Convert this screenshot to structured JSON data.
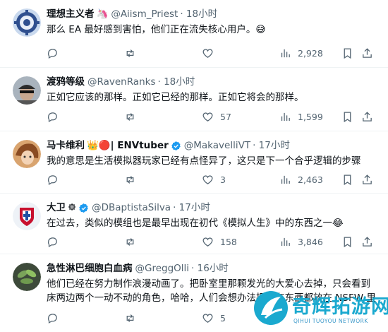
{
  "tweets": [
    {
      "name": "理想主义者",
      "name_emoji": "🦄",
      "handle": "@Aiism_Priest",
      "time": "· 18小时",
      "text": "那么 EA 最好感到害怕，他们正在流失核心用户。😅",
      "verified": false,
      "reply_count": "",
      "retweet_count": "",
      "like_count": "",
      "view_count": "2,928",
      "avatar_icon": "blue-gear-avatar"
    },
    {
      "name": "渡鸦等级",
      "name_emoji": "",
      "handle": "@RavenRanks",
      "time": "· 18小时",
      "text": "正如它应该的那样。正如它已经的那样。正如它将会的那样。",
      "verified": false,
      "reply_count": "",
      "retweet_count": "",
      "like_count": "57",
      "view_count": "1,599",
      "avatar_icon": "man-with-cap-avatar"
    },
    {
      "name": "马卡维利",
      "name_emoji": "👑🔴| ENVtuber",
      "handle": "@MakavelliVT",
      "time": "· 17小时",
      "text": "我的意思是生活模拟器玩家已经有点怪异了，这只是下一个合乎逻辑的步骤",
      "verified": true,
      "reply_count": "",
      "retweet_count": "",
      "like_count": "3",
      "view_count": "2,463",
      "avatar_icon": "anime-character-avatar"
    },
    {
      "name": "大卫",
      "name_emoji": "☸",
      "handle": "@DBaptistaSilva",
      "time": "· 17小时",
      "text": "在过去，类似的模组也是最早出现在初代《模拟人生》中的东西之一😂",
      "verified": true,
      "reply_count": "",
      "retweet_count": "",
      "like_count": "158",
      "view_count": "3,846",
      "avatar_icon": "flag-crest-avatar"
    },
    {
      "name": "急性淋巴细胞白血病",
      "name_emoji": "",
      "handle": "@GreggOlli",
      "time": "· 16小时",
      "text": "他们已经在努力制作浪漫动画了。把卧室里那颗发光的大爱心去掉，只会看到床两边两个一动不动的角色，哈哈，人们会想办法把所有东西都放在 NSFW 里",
      "verified": false,
      "reply_count": "",
      "retweet_count": "",
      "like_count": "5",
      "view_count": "",
      "avatar_icon": "plant-avatar"
    }
  ],
  "watermark": {
    "text": "奇辉拓游网",
    "sub": "QIHUI TUOYOU NETWORK",
    "color": "#1aa9cf"
  },
  "colors": {
    "text": "#0f1419",
    "muted": "#536471",
    "verified": "#1d9bf0",
    "divider": "#eff3f4"
  }
}
